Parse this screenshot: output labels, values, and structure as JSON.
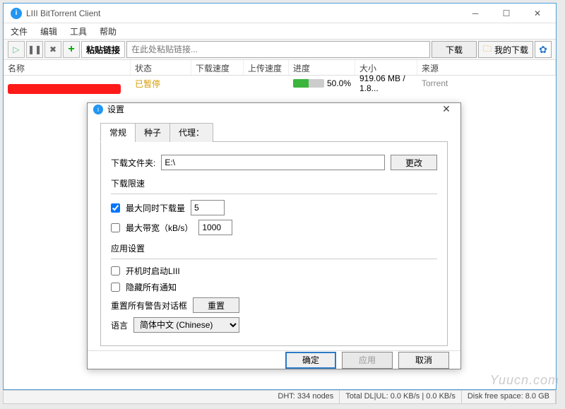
{
  "window": {
    "title": "LIII BitTorrent Client",
    "menu": {
      "file": "文件",
      "edit": "编辑",
      "tools": "工具",
      "help": "帮助"
    }
  },
  "toolbar": {
    "paste_link": "粘贴链接",
    "url_placeholder": "在此处粘贴链接...",
    "download": "下载",
    "my_downloads": "我的下载"
  },
  "columns": {
    "name": "名称",
    "status": "状态",
    "dlspeed": "下载速度",
    "ulspeed": "上传速度",
    "progress": "进度",
    "size": "大小",
    "source": "来源"
  },
  "rows": [
    {
      "name": "",
      "status": "已暂停",
      "progress_pct": "50.0%",
      "progress_val": 50,
      "size": "919.06 MB / 1.8...",
      "source": "Torrent"
    }
  ],
  "status": {
    "dht": "DHT: 334 nodes",
    "speeds": "Total DL|UL: 0.0 KB/s | 0.0 KB/s",
    "disk": "Disk free space: 8.0 GB"
  },
  "watermark": "Yuucn.com",
  "modal": {
    "title": "设置",
    "tabs": {
      "general": "常规",
      "seed": "种子",
      "proxy": "代理："
    },
    "download_folder_label": "下载文件夹:",
    "download_folder_value": "E:\\",
    "change": "更改",
    "limits_title": "下载限速",
    "max_concurrent_label": "最大同时下载量",
    "max_concurrent_value": "5",
    "max_bw_label": "最大带宽（kB/s）",
    "max_bw_value": "1000",
    "app_settings_title": "应用设置",
    "start_on_boot": "开机时启动LIII",
    "hide_notifications": "隐藏所有通知",
    "reset_warnings_label": "重置所有警告对话框",
    "reset": "重置",
    "language_label": "语言",
    "language_value": "简体中文 (Chinese)",
    "ok": "确定",
    "apply": "应用",
    "cancel": "取消"
  }
}
